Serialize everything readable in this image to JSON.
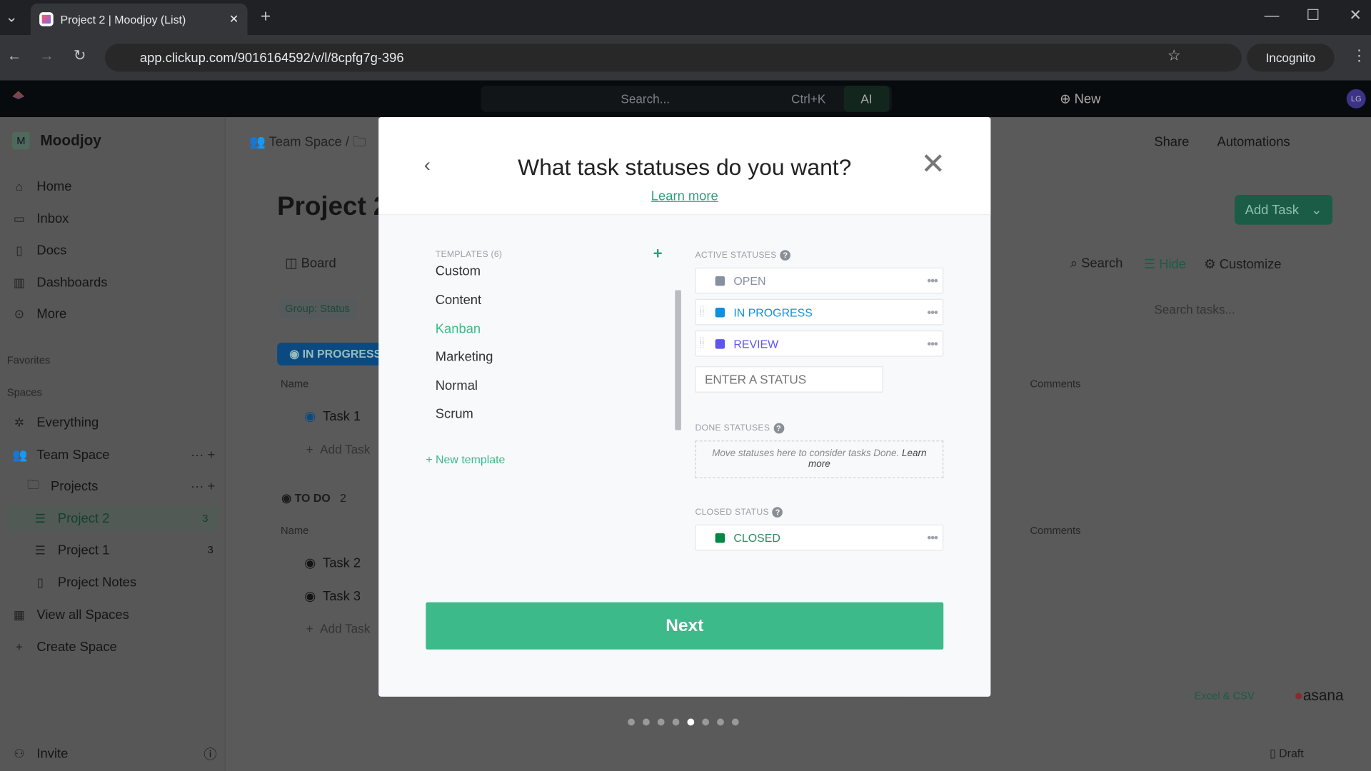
{
  "browser": {
    "tab_title": "Project 2 | Moodjoy (List)",
    "url": "app.clickup.com/9016164592/v/l/8cpfg7g-396",
    "incognito": "Incognito"
  },
  "apphead": {
    "search_placeholder": "Search...",
    "shortcut": "Ctrl+K",
    "ai": "AI",
    "new": "New",
    "avatar": "LG"
  },
  "sidebar": {
    "workspace": "Moodjoy",
    "workspace_initial": "M",
    "nav": [
      "Home",
      "Inbox",
      "Docs",
      "Dashboards",
      "More"
    ],
    "favorites": "Favorites",
    "spaces": "Spaces",
    "everything": "Everything",
    "team_space": "Team Space",
    "projects": "Projects",
    "lists": [
      {
        "label": "Project 2",
        "count": "3"
      },
      {
        "label": "Project 1",
        "count": "3"
      }
    ],
    "notes": "Project Notes",
    "view_all": "View all Spaces",
    "create": "Create Space",
    "invite": "Invite"
  },
  "main": {
    "breadcrumb_space": "Team Space",
    "title": "Project 2",
    "view_board": "Board",
    "group": "Group: Status",
    "share": "Share",
    "automations": "Automations",
    "add_task": "Add Task",
    "search": "Search",
    "hide": "Hide",
    "customize": "Customize",
    "search_tasks": "Search tasks...",
    "groups": [
      {
        "label": "IN PROGRESS",
        "tasks": [
          "Task 1"
        ]
      },
      {
        "label": "TO DO",
        "count": "2",
        "tasks": [
          "Task 2",
          "Task 3"
        ]
      }
    ],
    "col_name": "Name",
    "col_comments": "Comments",
    "add_task_row": "Add Task",
    "excel": "Excel & CSV",
    "asana": "asana",
    "draft": "Draft"
  },
  "modal": {
    "title": "What task statuses do you want?",
    "learn_more": "Learn more",
    "templates_label": "TEMPLATES (6)",
    "templates": [
      "Custom",
      "Content",
      "Kanban",
      "Marketing",
      "Normal",
      "Scrum"
    ],
    "selected_template": "Kanban",
    "new_template": "+ New template",
    "active_label": "ACTIVE STATUSES",
    "active": [
      {
        "name": "OPEN",
        "color": "#87909e"
      },
      {
        "name": "IN PROGRESS",
        "color": "#1090e0"
      },
      {
        "name": "REVIEW",
        "color": "#5f55ee"
      }
    ],
    "enter_placeholder": "ENTER A STATUS",
    "done_label": "DONE STATUSES",
    "done_hint": "Move statuses here to consider tasks Done.",
    "done_learn": "Learn more",
    "closed_label": "CLOSED STATUS",
    "closed": {
      "name": "CLOSED",
      "color": "#008844"
    },
    "next": "Next",
    "step_total": 8,
    "step_current": 5
  },
  "colors": {
    "accent": "#3dba89",
    "in_progress": "#1090e0"
  }
}
